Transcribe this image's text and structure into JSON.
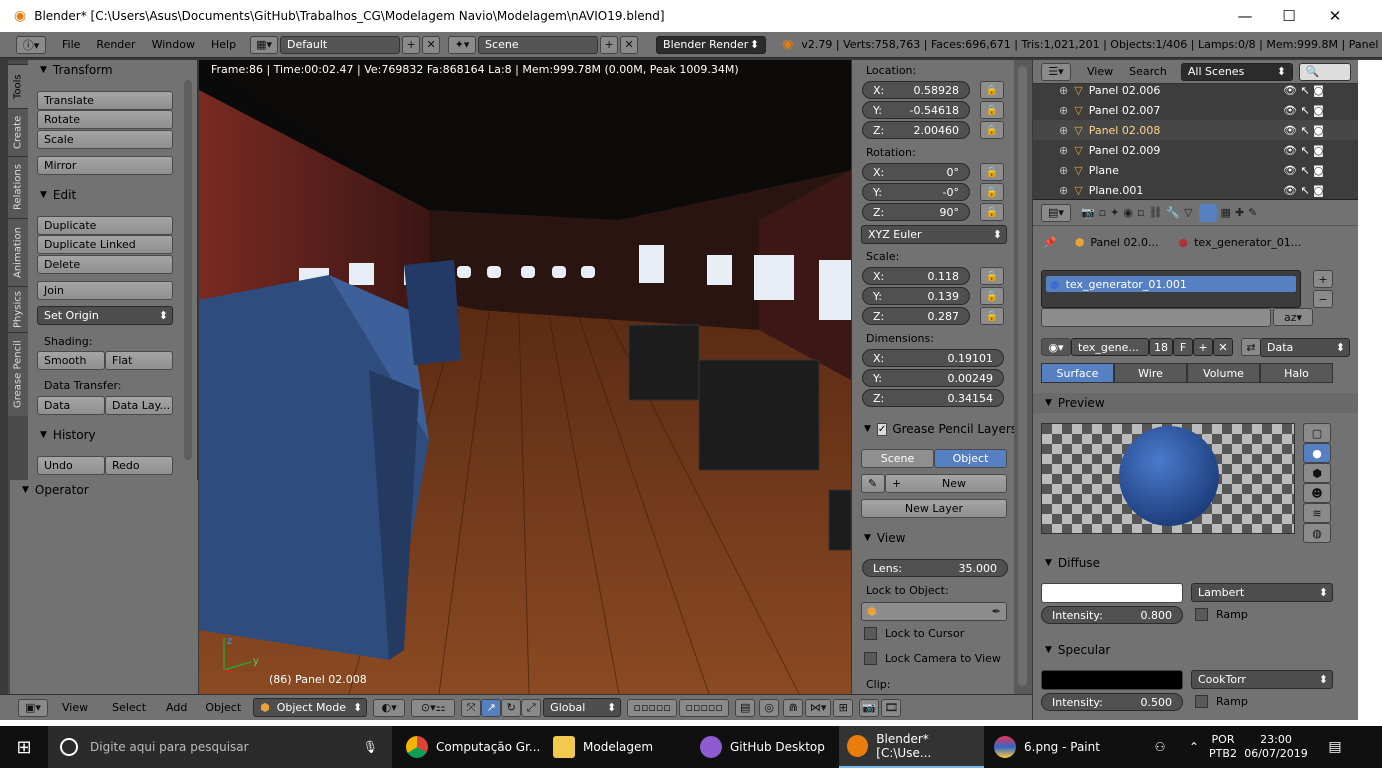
{
  "window": {
    "title": "Blender* [C:\\Users\\Asus\\Documents\\GitHub\\Trabalhos_CG\\Modelagem Navio\\Modelagem\\nAVIO19.blend]",
    "controls": [
      "—",
      "☐",
      "✕"
    ]
  },
  "info_header": {
    "menus": [
      "File",
      "Render",
      "Window",
      "Help"
    ],
    "screen_layout": "Default",
    "scene": "Scene",
    "render_engine": "Blender Render",
    "stats": "v2.79 | Verts:758,763 | Faces:696,671 | Tris:1,021,201 | Objects:1/406 | Lamps:0/8 | Mem:999.8M | Panel"
  },
  "tool_tabs": [
    "Tools",
    "Create",
    "Relations",
    "Animation",
    "Physics",
    "Grease Pencil"
  ],
  "tool_shelf": {
    "transform": {
      "title": "Transform",
      "buttons": [
        "Translate",
        "Rotate",
        "Scale",
        "Mirror"
      ]
    },
    "edit": {
      "title": "Edit",
      "buttons": [
        "Duplicate",
        "Duplicate Linked",
        "Delete",
        "Join"
      ],
      "set_origin": "Set Origin",
      "shading_label": "Shading:",
      "shading": [
        "Smooth",
        "Flat"
      ],
      "data_transfer_label": "Data Transfer:",
      "data_transfer": [
        "Data",
        "Data Lay..."
      ]
    },
    "history": {
      "title": "History",
      "buttons": [
        "Undo",
        "Redo"
      ]
    },
    "operator": {
      "title": "Operator"
    }
  },
  "viewport": {
    "render_info": "Frame:86 | Time:00:02.47 | Ve:769832 Fa:868164 La:8 | Mem:999.78M (0.00M, Peak 1009.34M)",
    "object_label": "(86) Panel 02.008",
    "axis_y": "y",
    "axis_z": "z"
  },
  "n_panel": {
    "location_label": "Location:",
    "location": [
      {
        "axis": "X:",
        "value": "0.58928"
      },
      {
        "axis": "Y:",
        "value": "-0.54618"
      },
      {
        "axis": "Z:",
        "value": "2.00460"
      }
    ],
    "rotation_label": "Rotation:",
    "rotation": [
      {
        "axis": "X:",
        "value": "0°"
      },
      {
        "axis": "Y:",
        "value": "-0°"
      },
      {
        "axis": "Z:",
        "value": "90°"
      }
    ],
    "rotation_mode": "XYZ Euler",
    "scale_label": "Scale:",
    "scale": [
      {
        "axis": "X:",
        "value": "0.118"
      },
      {
        "axis": "Y:",
        "value": "0.139"
      },
      {
        "axis": "Z:",
        "value": "0.287"
      }
    ],
    "dimensions_label": "Dimensions:",
    "dimensions": [
      {
        "axis": "X:",
        "value": "0.19101"
      },
      {
        "axis": "Y:",
        "value": "0.00249"
      },
      {
        "axis": "Z:",
        "value": "0.34154"
      }
    ],
    "grease_pencil_title": "Grease Pencil Layers",
    "gp_tabs": [
      "Scene",
      "Object"
    ],
    "gp_new": "New",
    "gp_new_layer": "New Layer",
    "view_title": "View",
    "lens_label": "Lens:",
    "lens_value": "35.000",
    "lock_to_object": "Lock to Object:",
    "lock_to_cursor": "Lock to Cursor",
    "lock_camera_to_view": "Lock Camera to View",
    "clip_label": "Clip:"
  },
  "outliner": {
    "view": "View",
    "search": "Search",
    "scenes": "All Scenes",
    "rows": [
      "Panel 02.006",
      "Panel 02.007",
      "Panel 02.008",
      "Panel 02.009",
      "Plane",
      "Plane.001"
    ],
    "selected_row": "Panel 02.008"
  },
  "properties": {
    "breadcrumb_object": "Panel 02.0...",
    "breadcrumb_material": "tex_generator_01...",
    "material_slot": "tex_generator_01.001",
    "material_name": "tex_gene...",
    "users": "18",
    "fake_user": "F",
    "link": "Data",
    "tabs": [
      "Surface",
      "Wire",
      "Volume",
      "Halo"
    ],
    "preview_title": "Preview",
    "diffuse_title": "Diffuse",
    "diffuse_shader": "Lambert",
    "diffuse_intensity_label": "Intensity:",
    "diffuse_intensity": "0.800",
    "ramp": "Ramp",
    "specular_title": "Specular",
    "specular_shader": "CookTorr",
    "specular_intensity_label": "Intensity:",
    "specular_intensity": "0.500"
  },
  "bottom_header": {
    "menus": [
      "View",
      "Select",
      "Add",
      "Object"
    ],
    "mode": "Object Mode",
    "orientation": "Global"
  },
  "taskbar": {
    "search_placeholder": "Digite aqui para pesquisar",
    "apps": [
      "Computação Gr...",
      "Modelagem",
      "GitHub Desktop",
      "Blender* [C:\\Use...",
      "6.png - Paint"
    ],
    "lang": "POR",
    "layout": "PTB2",
    "time": "23:00",
    "date": "06/07/2019"
  }
}
